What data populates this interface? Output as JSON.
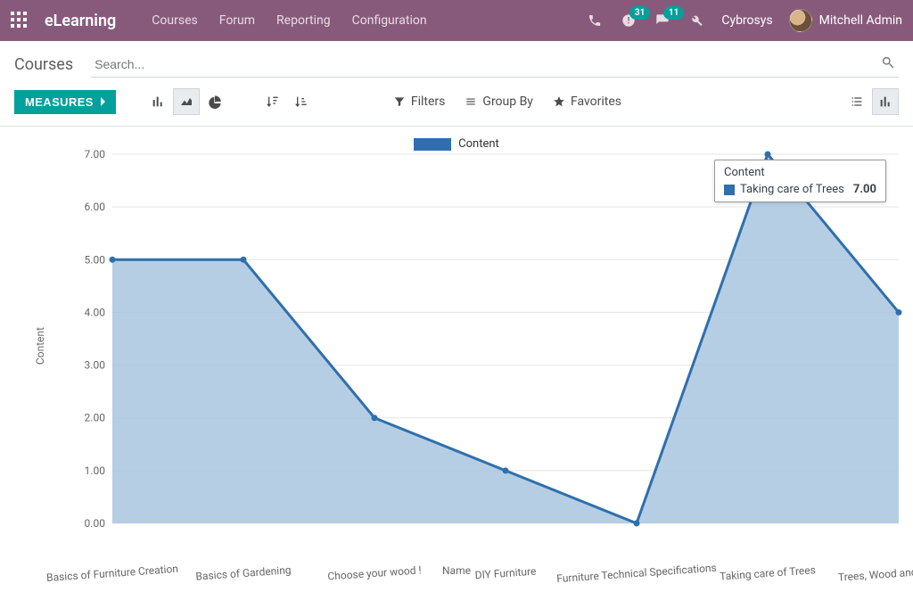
{
  "navbar": {
    "brand": "eLearning",
    "menu": [
      "Courses",
      "Forum",
      "Reporting",
      "Configuration"
    ],
    "badges": {
      "activities": "31",
      "messages": "11"
    },
    "system_name": "Cybrosys",
    "user_name": "Mitchell Admin"
  },
  "control_panel": {
    "title": "Courses",
    "search_placeholder": "Search...",
    "measures_label": "MEASURES",
    "filters_label": "Filters",
    "groupby_label": "Group By",
    "favorites_label": "Favorites"
  },
  "chart_data": {
    "type": "area",
    "title": "",
    "xlabel": "Name",
    "ylabel": "Content",
    "legend": "Content",
    "ylim": [
      0,
      7
    ],
    "yticks": [
      "0.00",
      "1.00",
      "2.00",
      "3.00",
      "4.00",
      "5.00",
      "6.00",
      "7.00"
    ],
    "categories": [
      "Basics of Furniture Creation",
      "Basics of Gardening",
      "Choose your wood !",
      "DIY Furniture",
      "Furniture Technical Specifications",
      "Taking care of Trees",
      "Trees, Wood and Gardens"
    ],
    "series": [
      {
        "name": "Content",
        "values": [
          5,
          5,
          2,
          1,
          0,
          7,
          4
        ]
      }
    ],
    "tooltip": {
      "title": "Content",
      "label": "Taking care of Trees",
      "value": "7.00",
      "point_index": 5
    },
    "colors": {
      "line": "#2f6fae",
      "fill": "#a9c6df"
    }
  }
}
